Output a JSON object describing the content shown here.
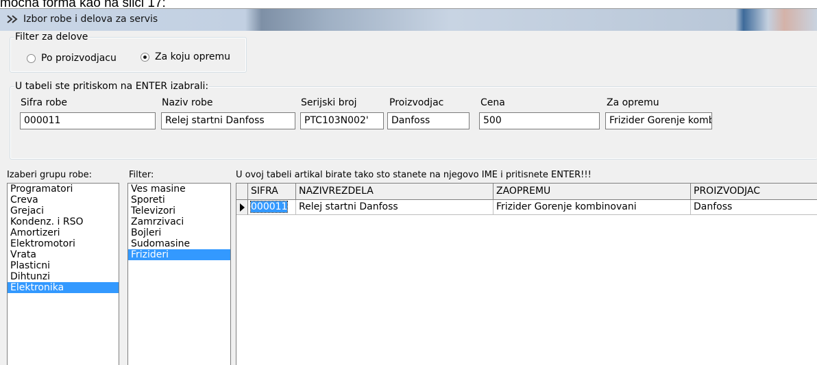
{
  "caption": "mocna forma kao na slici 17:",
  "window": {
    "title": "Izbor robe i delova za servis",
    "icon": "double-chevron-icon"
  },
  "filter_delove": {
    "legend": "Filter za delove",
    "options": [
      {
        "label": "Po proizvodjacu",
        "checked": false
      },
      {
        "label": "Za koju opremu",
        "checked": true
      }
    ]
  },
  "selection": {
    "legend": "U tabeli ste pritiskom na ENTER izabrali:",
    "fields": [
      {
        "label": "Sifra robe",
        "value": "000011"
      },
      {
        "label": "Naziv robe",
        "value": "Relej startni Danfoss"
      },
      {
        "label": "Serijski broj",
        "value": "PTC103N002'"
      },
      {
        "label": "Proizvodjac",
        "value": "Danfoss"
      },
      {
        "label": "Cena",
        "value": "500"
      },
      {
        "label": "Za opremu",
        "value": "Frizider Gorenje komb"
      }
    ]
  },
  "groups": {
    "label": "Izaberi grupu robe:",
    "items": [
      "Programatori",
      "Creva",
      "Grejaci",
      "Kondenz. i RSO",
      "Amortizeri",
      "Elektromotori",
      "Vrata",
      "Plasticni",
      "Dihtunzi",
      "Elektronika"
    ],
    "selected": "Elektronika"
  },
  "filter": {
    "label": "Filter:",
    "items": [
      "Ves masine",
      "Sporeti",
      "Televizori",
      "Zamrzivaci",
      "Bojleri",
      "Sudomasine",
      "Frizideri"
    ],
    "selected": "Frizideri"
  },
  "table": {
    "instruction": "U ovoj tabeli artikal birate tako sto stanete na njegovo IME i pritisnete ENTER!!!",
    "columns": [
      "SIFRA",
      "NAZIVREZDELA",
      "ZAOPREMU",
      "PROIZVODJAC"
    ],
    "rows": [
      [
        "000011",
        "Relej startni Danfoss",
        "Frizider Gorenje kombinovani",
        "Danfoss"
      ]
    ]
  },
  "colors": {
    "selection": "#3399ff",
    "face": "#f0f0f0"
  }
}
